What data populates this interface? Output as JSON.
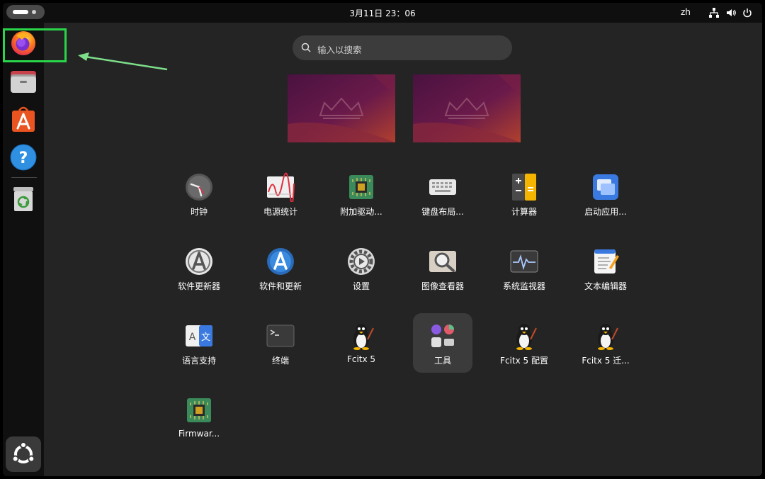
{
  "topbar": {
    "datetime": "3月11日  23：06",
    "language": "zh",
    "tray_icons": [
      "network-icon",
      "volume-icon",
      "power-icon"
    ]
  },
  "dock": {
    "items": [
      {
        "name": "Firefox",
        "icon": "firefox-icon"
      },
      {
        "name": "Files",
        "icon": "files-icon"
      },
      {
        "name": "App Center",
        "icon": "app-center-icon"
      },
      {
        "name": "Help",
        "icon": "help-icon"
      },
      {
        "name": "Trash",
        "icon": "trash-icon"
      }
    ],
    "show_apps_icon": "ubuntu-logo-icon"
  },
  "annotation": {
    "highlight_color": "#29d64a",
    "target": "firefox-icon"
  },
  "search": {
    "placeholder": "输入以搜索"
  },
  "workspaces": {
    "count": 2,
    "wallpaper_colors": [
      "#5a1a4a",
      "#8a2a3a",
      "#c04a2a"
    ]
  },
  "apps": [
    {
      "label": "时钟",
      "icon": "clock-icon"
    },
    {
      "label": "电源统计",
      "icon": "power-statistics-icon"
    },
    {
      "label": "附加驱动...",
      "icon": "additional-drivers-icon"
    },
    {
      "label": "键盘布局...",
      "icon": "keyboard-layout-icon"
    },
    {
      "label": "计算器",
      "icon": "calculator-icon"
    },
    {
      "label": "启动应用...",
      "icon": "startup-applications-icon"
    },
    {
      "label": "软件更新器",
      "icon": "software-updater-icon"
    },
    {
      "label": "软件和更新",
      "icon": "software-and-updates-icon"
    },
    {
      "label": "设置",
      "icon": "settings-gear-icon"
    },
    {
      "label": "图像查看器",
      "icon": "image-viewer-icon"
    },
    {
      "label": "系统监视器",
      "icon": "system-monitor-icon"
    },
    {
      "label": "文本编辑器",
      "icon": "text-editor-icon"
    },
    {
      "label": "语言支持",
      "icon": "language-support-icon"
    },
    {
      "label": "终端",
      "icon": "terminal-icon"
    },
    {
      "label": "Fcitx 5",
      "icon": "fcitx-penguin-icon"
    },
    {
      "label": "工具",
      "icon": "utilities-folder-icon",
      "selected": true
    },
    {
      "label": "Fcitx 5 配置",
      "icon": "fcitx-config-penguin-icon"
    },
    {
      "label": "Fcitx 5 迁...",
      "icon": "fcitx-migrator-penguin-icon"
    },
    {
      "label": "Firmwar...",
      "icon": "firmware-chip-icon"
    }
  ]
}
